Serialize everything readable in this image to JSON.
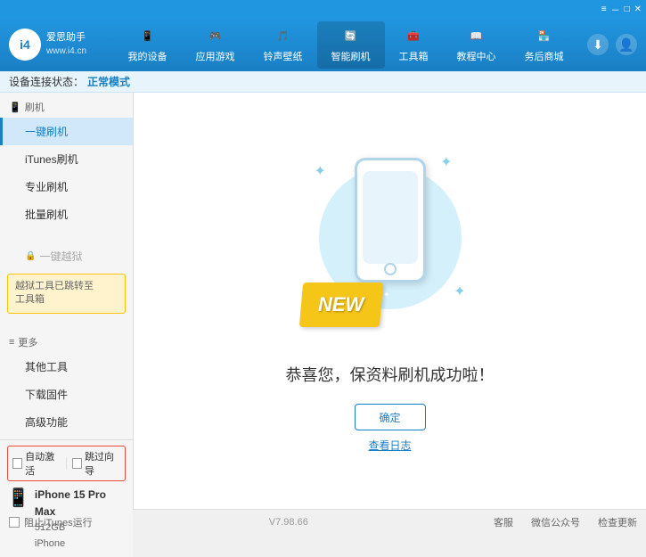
{
  "app": {
    "title": "爱思助手",
    "subtitle": "www.i4.cn"
  },
  "topbar": {
    "icons": [
      "wifi",
      "minus",
      "square",
      "close"
    ]
  },
  "nav": {
    "items": [
      {
        "id": "my-device",
        "label": "我的设备",
        "icon": "📱"
      },
      {
        "id": "apps-games",
        "label": "应用游戏",
        "icon": "👤"
      },
      {
        "id": "ringtones",
        "label": "铃声壁纸",
        "icon": "🖼"
      },
      {
        "id": "smart-flash",
        "label": "智能刷机",
        "icon": "🔄"
      },
      {
        "id": "toolbox",
        "label": "工具箱",
        "icon": "🧰"
      },
      {
        "id": "tutorials",
        "label": "教程中心",
        "icon": "🎓"
      },
      {
        "id": "service-area",
        "label": "务后商城",
        "icon": "🏪"
      }
    ],
    "active": "smart-flash",
    "download_icon": "⬇",
    "user_icon": "👤"
  },
  "breadcrumb": {
    "prefix": "设备连接状态：",
    "status": "正常模式"
  },
  "sidebar": {
    "flash_label": "刷机",
    "items_flash": [
      {
        "id": "one-key-flash",
        "label": "一键刷机",
        "active": true
      },
      {
        "id": "itunes-flash",
        "label": "iTunes刷机"
      },
      {
        "id": "pro-flash",
        "label": "专业刷机"
      },
      {
        "id": "batch-flash",
        "label": "批量刷机"
      }
    ],
    "jailbreak_label": "一键越狱",
    "jailbreak_disabled": true,
    "notice_text": "越狱工具已跳转至\n工具箱",
    "more_label": "更多",
    "items_more": [
      {
        "id": "other-tools",
        "label": "其他工具"
      },
      {
        "id": "download-firmware",
        "label": "下载固件"
      },
      {
        "id": "advanced",
        "label": "高级功能"
      }
    ],
    "auto_activate": "自动激活",
    "time_activate": "跳过向导",
    "device_name": "iPhone 15 Pro Max",
    "device_storage": "512GB",
    "device_type": "iPhone"
  },
  "content": {
    "success_message": "恭喜您，保资料刷机成功啦！",
    "confirm_button": "确定",
    "log_link": "查看日志"
  },
  "statusbar": {
    "itunes_label": "阻止iTunes运行",
    "version": "V7.98.66",
    "links": [
      {
        "id": "desktop",
        "label": "客服"
      },
      {
        "id": "wechat",
        "label": "微信公众号"
      },
      {
        "id": "check-update",
        "label": "检查更新"
      }
    ]
  }
}
